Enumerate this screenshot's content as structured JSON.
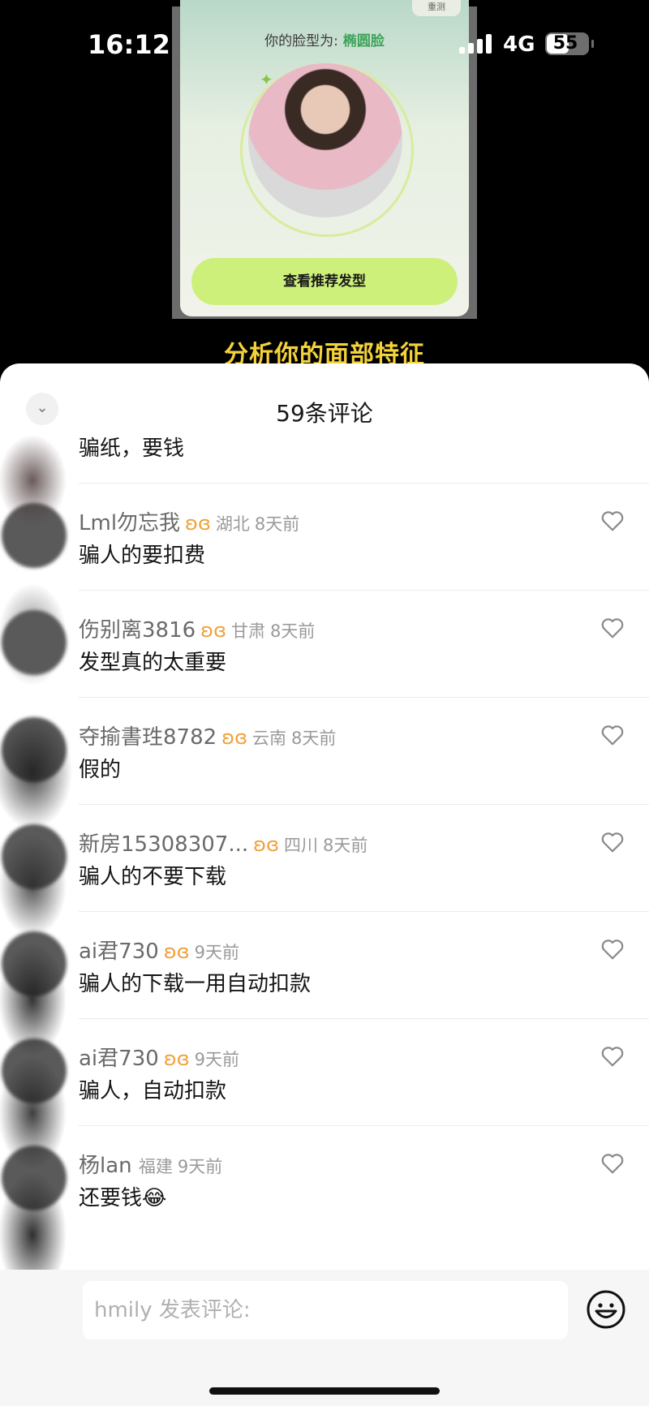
{
  "status_bar": {
    "time": "16:12",
    "network": "4G",
    "battery": "55"
  },
  "video": {
    "face_label": "你的脸型为:",
    "face_shape": "椭圆脸",
    "button_label": "查看推荐发型",
    "top_icon_label": "重测",
    "subtitle": "分析你的面部特征"
  },
  "sheet": {
    "title": "59条评论"
  },
  "comments": [
    {
      "username": "",
      "region": "",
      "time": "",
      "text": "骗纸，要钱"
    },
    {
      "username": "Lml勿忘我",
      "region": "湖北",
      "time": "8天前",
      "text": "骗人的要扣费"
    },
    {
      "username": "伤别离3816",
      "region": "甘肃",
      "time": "8天前",
      "text": "发型真的太重要"
    },
    {
      "username": "夺揄書珄8782",
      "region": "云南",
      "time": "8天前",
      "text": "假的"
    },
    {
      "username": "新房15308307...",
      "region": "四川",
      "time": "8天前",
      "text": "骗人的不要下载"
    },
    {
      "username": "ai君730",
      "region": "",
      "time": "9天前",
      "text": "骗人的下载一用自动扣款"
    },
    {
      "username": "ai君730",
      "region": "",
      "time": "9天前",
      "text": "骗人，自动扣款"
    },
    {
      "username": "杨lan",
      "region": "福建",
      "time": "9天前",
      "text": "还要钱😂"
    }
  ],
  "input": {
    "placeholder": "hmily 发表评论:"
  },
  "icons": {
    "badge": "butterfly-badge-icon",
    "like": "heart-outline-icon",
    "emoji": "smiley-icon",
    "collapse": "chevron-down-icon"
  },
  "colors": {
    "badge": "#f0a13a",
    "subtitle": "#f4d23a",
    "button": "#cdf07a",
    "face_shape": "#3fa35a"
  }
}
